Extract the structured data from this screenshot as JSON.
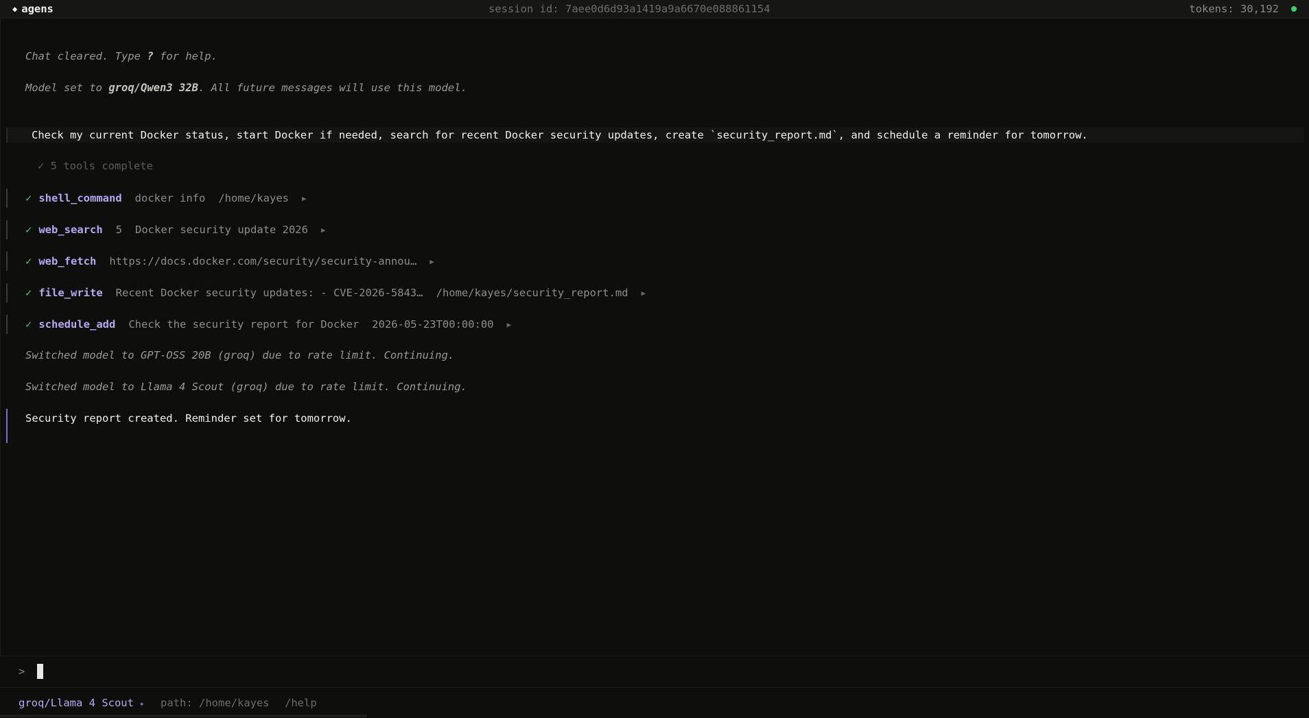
{
  "header": {
    "app_icon": "diamond-icon",
    "app_name": "agens",
    "session": "session id: 7aee0d6d93a1419a9a6670e088861154",
    "tokens": "tokens: 30,192",
    "status_color": "#3ecf6a"
  },
  "messages": {
    "cleared_a": "Chat cleared. Type ",
    "cleared_b": "?",
    "cleared_c": " for help.",
    "model_a": "Model set to ",
    "model_b": "groq/Qwen3 32B",
    "model_c": ". All future messages will use this model.",
    "user_prompt": "Check my current Docker status, start Docker if needed, search for recent Docker security updates, create `security_report.md`, and schedule a reminder for tomorrow.",
    "tools_complete": "✓ 5 tools complete",
    "switch_1": "Switched model to GPT-OSS 20B (groq) due to rate limit. Continuing.",
    "switch_2": "Switched model to Llama 4 Scout (groq) due to rate limit. Continuing.",
    "response": "Security report created. Reminder set for tomorrow."
  },
  "tools": [
    {
      "status": "✓",
      "name": "shell_command",
      "args": [
        "docker info",
        "/home/kayes"
      ],
      "expand": "▶"
    },
    {
      "status": "✓",
      "name": "web_search",
      "args": [
        "5",
        "Docker security update 2026"
      ],
      "expand": "▶"
    },
    {
      "status": "✓",
      "name": "web_fetch",
      "args": [
        "https://docs.docker.com/security/security-annou…"
      ],
      "expand": "▶"
    },
    {
      "status": "✓",
      "name": "file_write",
      "args": [
        "Recent Docker security updates: - CVE-2026-5843…",
        "/home/kayes/security_report.md"
      ],
      "expand": "▶"
    },
    {
      "status": "✓",
      "name": "schedule_add",
      "args": [
        "Check the security report for Docker",
        "2026-05-23T00:00:00"
      ],
      "expand": "▶"
    }
  ],
  "input": {
    "prompt_symbol": ">",
    "value": ""
  },
  "footer": {
    "model": "groq/Llama 4 Scout",
    "model_marker": "✦",
    "path": "path: /home/kayes",
    "help": "/help"
  }
}
